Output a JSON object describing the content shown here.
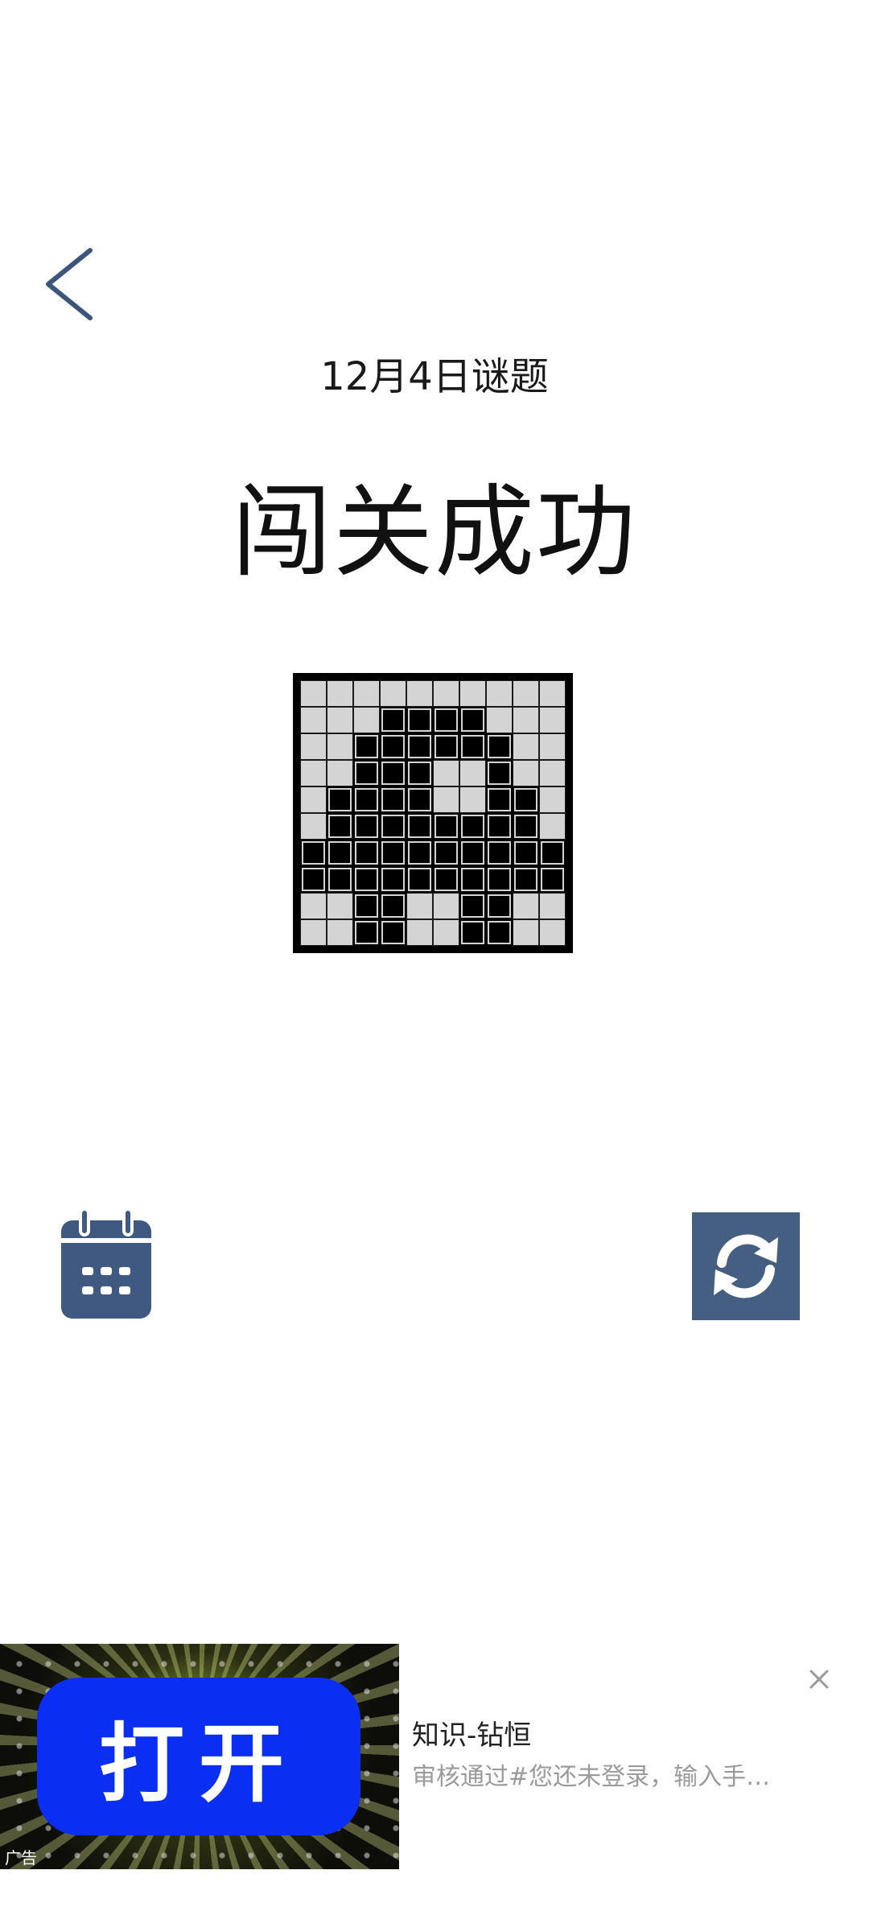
{
  "header": {
    "back_icon": "chevron-left-icon"
  },
  "puzzle": {
    "date_label": "12月4日谜题",
    "result_title": "闯关成功",
    "grid": [
      [
        0,
        0,
        0,
        0,
        0,
        0,
        0,
        0,
        0,
        0
      ],
      [
        0,
        0,
        0,
        1,
        1,
        1,
        1,
        0,
        0,
        0
      ],
      [
        0,
        0,
        1,
        1,
        1,
        1,
        1,
        1,
        0,
        0
      ],
      [
        0,
        0,
        1,
        1,
        1,
        0,
        0,
        1,
        0,
        0
      ],
      [
        0,
        1,
        1,
        1,
        1,
        0,
        0,
        1,
        1,
        0
      ],
      [
        0,
        1,
        1,
        1,
        1,
        1,
        1,
        1,
        1,
        0
      ],
      [
        1,
        1,
        1,
        1,
        1,
        1,
        1,
        1,
        1,
        1
      ],
      [
        1,
        1,
        1,
        1,
        1,
        1,
        1,
        1,
        1,
        1
      ],
      [
        0,
        0,
        1,
        1,
        0,
        0,
        1,
        1,
        0,
        0
      ],
      [
        0,
        0,
        1,
        1,
        0,
        0,
        1,
        1,
        0,
        0
      ]
    ]
  },
  "actions": {
    "calendar_icon": "calendar-icon",
    "refresh_icon": "refresh-icon",
    "accent_color": "#455f82"
  },
  "ad": {
    "open_button_label": "打开",
    "tag_label": "广告",
    "title": "知识-钻恒",
    "description": "审核通过#您还未登录，输入手机号即可登录",
    "close_icon": "close-icon",
    "button_color": "#0a2ef2"
  }
}
